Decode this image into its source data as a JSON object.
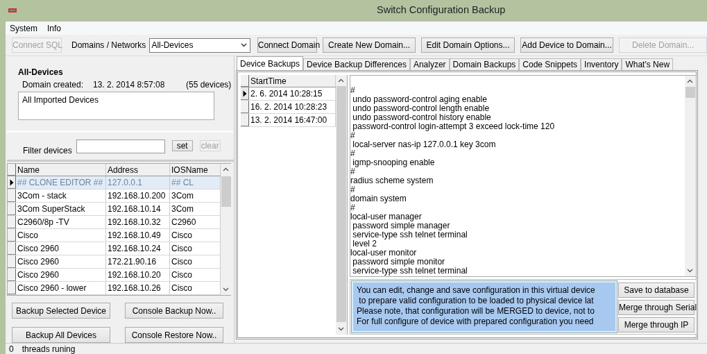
{
  "window": {
    "title": "Switch Configuration Backup"
  },
  "menu": [
    "System",
    "Info"
  ],
  "toolbar": {
    "connect_sql": {
      "label": "Connect SQL",
      "disabled": true
    },
    "domains_label": "Domains / Networks",
    "domain_select": {
      "value": "All-Devices"
    },
    "buttons": [
      {
        "label": "Connect Domain",
        "disabled": false
      },
      {
        "label": "Create New Domain...",
        "disabled": false
      },
      {
        "label": "Edit Domain Options...",
        "disabled": false
      },
      {
        "label": "Add Device to Domain...",
        "disabled": false
      },
      {
        "label": "Delete Domain...",
        "disabled": true
      }
    ]
  },
  "domain_info": {
    "name": "All-Devices",
    "created_label": "Domain created:",
    "created": "13. 2. 2014 8:57:08",
    "count": "(55 devices)",
    "description": "All Imported Devices"
  },
  "filter": {
    "label": "Filter devices",
    "set_button": {
      "label": "set",
      "disabled": false
    },
    "clear_button": {
      "label": "clear",
      "disabled": true
    }
  },
  "device_grid": {
    "columns": [
      "Name",
      "Address",
      "IOSName"
    ],
    "rows": [
      {
        "cells": [
          "## CLONE EDITOR ##",
          "127.0.0.1",
          "## CL"
        ],
        "selected": true
      },
      {
        "cells": [
          "3Com - stack",
          "192.168.10.200",
          "3Com"
        ],
        "selected": false
      },
      {
        "cells": [
          "3Com SuperStack",
          "192.168.10.14",
          "3Com"
        ],
        "selected": false
      },
      {
        "cells": [
          "C2960/8p -TV",
          "192.168.10.32",
          "C2960"
        ],
        "selected": false
      },
      {
        "cells": [
          "Cisco",
          "192.168.10.49",
          "Cisco"
        ],
        "selected": false
      },
      {
        "cells": [
          "Cisco 2960",
          "192.168.10.24",
          "Cisco"
        ],
        "selected": false
      },
      {
        "cells": [
          "Cisco 2960",
          "172.21.90.16",
          "Cisco"
        ],
        "selected": false
      },
      {
        "cells": [
          "Cisco 2960",
          "192.168.10.20",
          "Cisco"
        ],
        "selected": false
      },
      {
        "cells": [
          "Cisco 2960 - lower",
          "192.168.10.26",
          "Cisco"
        ],
        "selected": false
      }
    ]
  },
  "device_actions": [
    "Backup Selected Device",
    "Console Backup Now..",
    "Backup All Devices",
    "Console Restore Now.."
  ],
  "status_bar": {
    "count": "0",
    "text": "threads runing"
  },
  "tabs": [
    {
      "label": "Device Backups",
      "selected": true
    },
    {
      "label": "Device Backup Differences",
      "selected": false
    },
    {
      "label": "Analyzer",
      "selected": false
    },
    {
      "label": "Domain Backups",
      "selected": false
    },
    {
      "label": "Code Snippets",
      "selected": false
    },
    {
      "label": "Inventory",
      "selected": false
    },
    {
      "label": "What's New",
      "selected": false
    }
  ],
  "backups": {
    "columns": [
      "StartTime"
    ],
    "rows": [
      {
        "start_time": "2. 6. 2014 10:28:15",
        "selected": true
      },
      {
        "start_time": "16. 2. 2014 10:28:23",
        "selected": false
      },
      {
        "start_time": "13. 2. 2014 16:47:00",
        "selected": false
      }
    ]
  },
  "config_lines": [
    "#",
    " undo password-control aging enable",
    " undo password-control length enable",
    " undo password-control history enable",
    " password-control login-attempt 3 exceed lock-time 120",
    "#",
    " local-server nas-ip 127.0.0.1 key 3com",
    "#",
    " igmp-snooping enable",
    "#",
    "radius scheme system",
    "#",
    "domain system",
    "#",
    "local-user manager",
    " password simple manager",
    " service-type ssh telnet terminal",
    " level 2",
    "local-user monitor",
    " password simple monitor",
    " service-type ssh telnet terminal"
  ],
  "note_lines": [
    "You can edit, change and save configuration in this virtual device",
    " to prepare valid configuration to be loaded to physical device lat",
    "Please note, that configuration will be MERGED to device, not to",
    "For full configure of device with prepared configuration you need"
  ],
  "config_actions": [
    "Save to database",
    "Merge through Serial",
    "Merge through IP"
  ]
}
